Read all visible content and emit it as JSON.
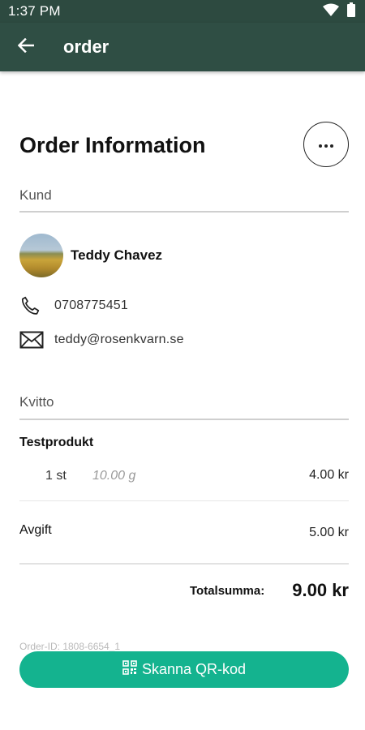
{
  "status_bar": {
    "time": "1:37 PM"
  },
  "app_bar": {
    "title": "order",
    "back_icon": "arrow-left-icon"
  },
  "page": {
    "title": "Order Information",
    "more_icon": "more-horizontal-icon"
  },
  "customer": {
    "section_label": "Kund",
    "name": "Teddy Chavez",
    "phone": "0708775451",
    "email": "teddy@rosenkvarn.se"
  },
  "receipt": {
    "section_label": "Kvitto",
    "product": {
      "name": "Testprodukt",
      "quantity": "1 st",
      "weight": "10.00 g",
      "price": "4.00 kr"
    },
    "fee": {
      "label": "Avgift",
      "value": "5.00 kr"
    },
    "total": {
      "label": "Totalsumma:",
      "value": "9.00 kr"
    }
  },
  "order_id": "Order-ID: 1808-6654_1",
  "scan_button": {
    "label": "Skanna QR-kod",
    "icon": "qr-code-icon"
  },
  "colors": {
    "status_bar": "#2d4a40",
    "app_bar": "#2f4e44",
    "accent": "#14b38f"
  }
}
